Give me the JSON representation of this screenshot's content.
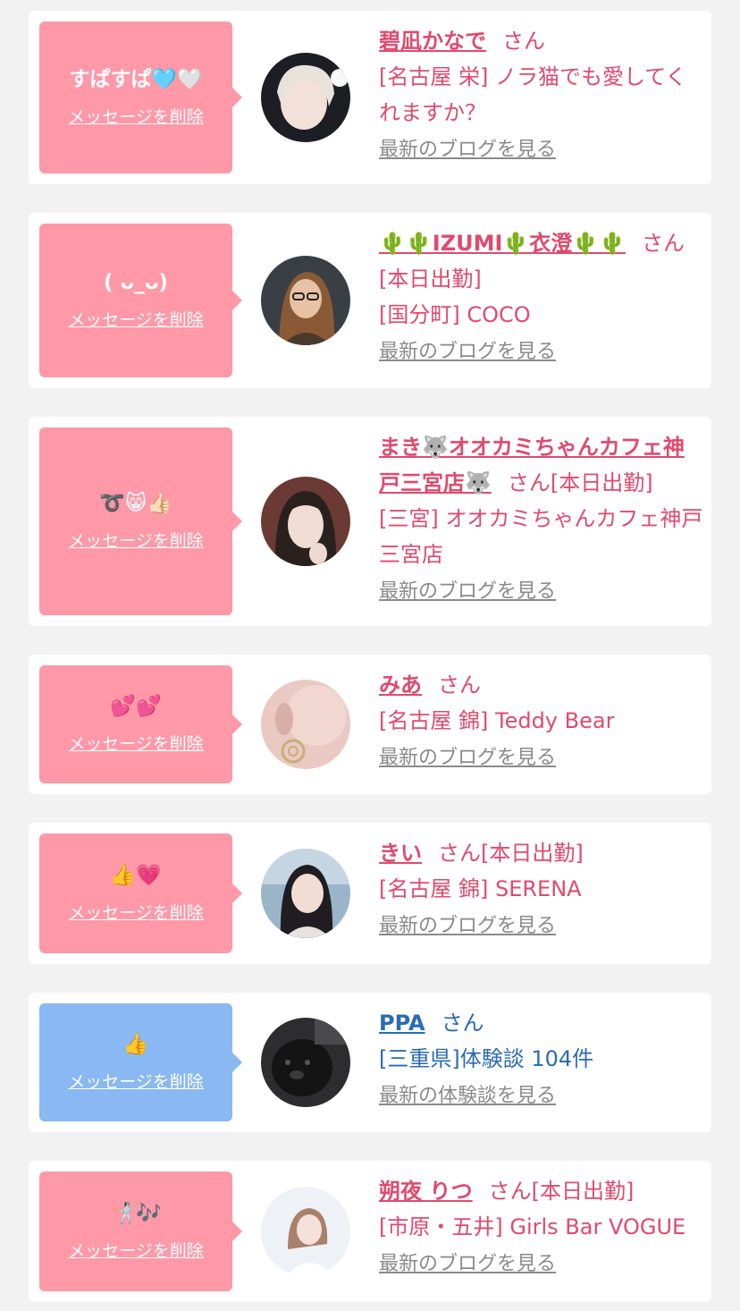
{
  "colors": {
    "pink_bubble": "#ff98a7",
    "blue_bubble": "#89b8f2",
    "pink_text": "#e04a6e",
    "blue_text": "#2a6bb4",
    "link_gray": "#8a8a8a"
  },
  "common": {
    "delete_label": "メッセージを削除",
    "san_label": "さん",
    "san_with_shift": "さん[本日出勤]"
  },
  "items": [
    {
      "message": "すぱすぱ🩵🤍",
      "name": "碧凪かなで",
      "suffix": "さん",
      "shop": "[名古屋 栄] ノラ猫でも愛してくれますか？",
      "link": "最新のブログを見る",
      "avatar_icon": "avatar-photo"
    },
    {
      "message": "( ᴗ_ᴗ)",
      "name": "🌵🌵IZUMI🌵衣澄🌵🌵",
      "suffix": "さん[本日出勤]",
      "shop": "[国分町] COCO",
      "link": "最新のブログを見る",
      "avatar_icon": "avatar-photo"
    },
    {
      "message": "➰😸👍🏻",
      "name": "まき🐺オオカミちゃんカフェ神戸三宮店🐺",
      "suffix": "さん[本日出勤]",
      "shop": "[三宮] オオカミちゃんカフェ神戸三宮店",
      "link": "最新のブログを見る",
      "avatar_icon": "avatar-photo"
    },
    {
      "message": "💕💕",
      "name": "みあ",
      "suffix": "さん",
      "shop": "[名古屋 錦] Teddy Bear",
      "link": "最新のブログを見る",
      "avatar_icon": "avatar-photo"
    },
    {
      "message": "👍💗",
      "name": "きい",
      "suffix": "さん[本日出勤]",
      "shop": "[名古屋 錦] SERENA",
      "link": "最新のブログを見る",
      "avatar_icon": "avatar-photo"
    },
    {
      "message": "👍",
      "name": "PPA",
      "suffix": "さん",
      "shop": "[三重県]体験談 104件",
      "link": "最新の体験談を見る",
      "avatar_icon": "avatar-photo"
    },
    {
      "message": "🤺🎶",
      "name": "朔夜 りつ",
      "suffix": "さん[本日出勤]",
      "shop": "[市原・五井] Girls Bar VOGUE",
      "link": "最新のブログを見る",
      "avatar_icon": "avatar-photo"
    }
  ]
}
